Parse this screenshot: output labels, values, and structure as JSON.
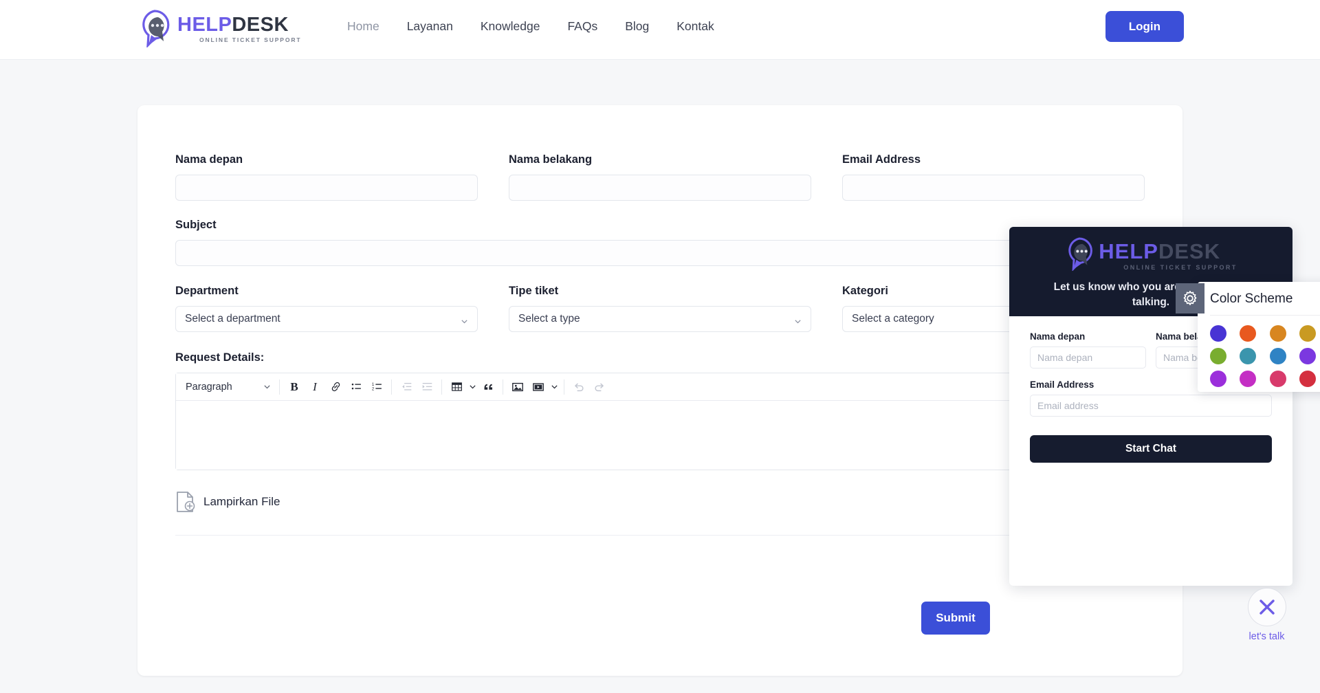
{
  "header": {
    "logo": {
      "main_1": "HELP",
      "main_2": "DESK",
      "sub": "ONLINE TICKET SUPPORT",
      "icon": "chat-bubble-icon"
    },
    "nav": [
      {
        "label": "Home",
        "active": true
      },
      {
        "label": "Layanan",
        "active": false
      },
      {
        "label": "Knowledge",
        "active": false
      },
      {
        "label": "FAQs",
        "active": false
      },
      {
        "label": "Blog",
        "active": false
      },
      {
        "label": "Kontak",
        "active": false
      }
    ],
    "login_label": "Login",
    "login_color": "#3b4fd8"
  },
  "form": {
    "first_name": {
      "label": "Nama depan",
      "value": ""
    },
    "last_name": {
      "label": "Nama belakang",
      "value": ""
    },
    "email": {
      "label": "Email Address",
      "value": ""
    },
    "subject": {
      "label": "Subject",
      "value": ""
    },
    "department": {
      "label": "Department",
      "selected": "Select a department"
    },
    "ticket_type": {
      "label": "Tipe tiket",
      "selected": "Select a type"
    },
    "category": {
      "label": "Kategori",
      "selected": "Select a category"
    },
    "request_details_label": "Request Details:",
    "editor": {
      "block_format": "Paragraph",
      "buttons": [
        {
          "name": "bold-icon",
          "glyph": "B"
        },
        {
          "name": "italic-icon",
          "glyph": "I"
        },
        {
          "name": "link-icon",
          "glyph": "link"
        },
        {
          "name": "bullet-list-icon",
          "glyph": "ul"
        },
        {
          "name": "numbered-list-icon",
          "glyph": "ol"
        },
        {
          "name": "outdent-icon",
          "glyph": "outdent"
        },
        {
          "name": "indent-icon",
          "glyph": "indent"
        },
        {
          "name": "table-icon",
          "glyph": "table"
        },
        {
          "name": "blockquote-icon",
          "glyph": "quote"
        },
        {
          "name": "image-icon",
          "glyph": "image"
        },
        {
          "name": "video-icon",
          "glyph": "video"
        },
        {
          "name": "undo-icon",
          "glyph": "undo"
        },
        {
          "name": "redo-icon",
          "glyph": "redo"
        }
      ],
      "content": ""
    },
    "attach_label": "Lampirkan File",
    "submit_label": "Submit"
  },
  "chat_widget": {
    "logo": {
      "main_1": "HELP",
      "main_2": "DESK",
      "sub": "ONLINE TICKET SUPPORT"
    },
    "tagline": "Let us know who you are, and let's get talking.",
    "first_name": {
      "label": "Nama depan",
      "placeholder": "Nama depan",
      "value": ""
    },
    "last_name": {
      "label": "Nama belakang",
      "placeholder": "Nama belakang",
      "value": ""
    },
    "email": {
      "label": "Email Address",
      "placeholder": "Email address",
      "value": ""
    },
    "start_label": "Start Chat",
    "header_bg": "#151b2e"
  },
  "color_scheme": {
    "title": "Color Scheme",
    "swatches": [
      "#4834d4",
      "#e8591f",
      "#d88620",
      "#c99a22",
      "#79ad2f",
      "#3b95ad",
      "#2f83c4",
      "#7b38e0",
      "#9b2fdb",
      "#c42fc4",
      "#d83a6b",
      "#d42f3f"
    ]
  },
  "launcher": {
    "label": "let's talk",
    "icon": "close-x-icon",
    "accent": "#6c5ce7"
  }
}
